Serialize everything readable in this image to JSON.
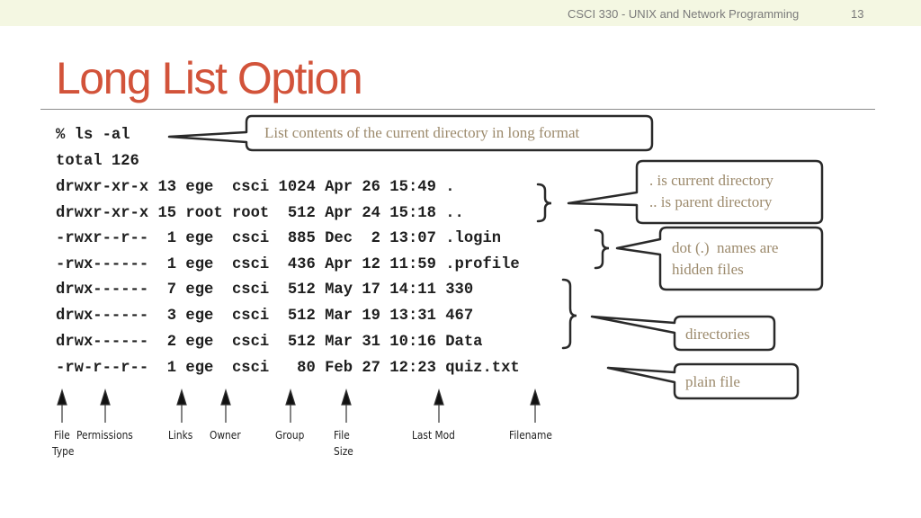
{
  "header": {
    "course": "CSCI 330 - UNIX and Network Programming",
    "page_number": "13",
    "background_color": "#f4f7e2"
  },
  "slide": {
    "title": "Long List Option",
    "title_color": "#d2533a"
  },
  "terminal": {
    "command": "% ls -al",
    "total": "total 126",
    "rows": [
      "drwxr-xr-x 13 ege  csci 1024 Apr 26 15:49 .",
      "drwxr-xr-x 15 root root  512 Apr 24 15:18 ..",
      "-rwxr--r--  1 ege  csci  885 Dec  2 13:07 .login",
      "-rwx------  1 ege  csci  436 Apr 12 11:59 .profile",
      "drwx------  7 ege  csci  512 May 17 14:11 330",
      "drwx------  3 ege  csci  512 Mar 19 13:31 467",
      "drwx------  2 ege  csci  512 Mar 31 10:16 Data",
      "-rw-r--r--  1 ege  csci   80 Feb 27 12:23 quiz.txt"
    ]
  },
  "callouts": {
    "command": "List contents of the current directory in long format",
    "dot_line1": ". is current directory",
    "dot_line2": ".. is parent directory",
    "hidden_line1": "dot (.)  names are",
    "hidden_line2": "hidden files",
    "directories": "directories",
    "plain_file": "plain file",
    "text_color": "#9c8a6c"
  },
  "column_labels": {
    "file_type_1": "File",
    "file_type_2": "Type",
    "permissions": "Permissions",
    "links": "Links",
    "owner": "Owner",
    "group": "Group",
    "file_size_1": "File",
    "file_size_2": "Size",
    "last_mod": "Last Mod",
    "filename": "Filename"
  }
}
